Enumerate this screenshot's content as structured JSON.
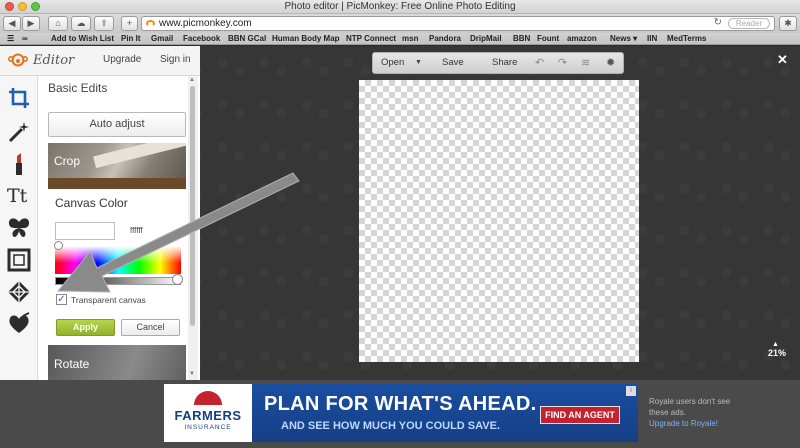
{
  "browser": {
    "window_title": "Photo editor | PicMonkey: Free Online Photo Editing",
    "url": "www.picmonkey.com",
    "reader_label": "Reader",
    "bookmarks": [
      "Add to Wish List",
      "Pin It",
      "Gmail",
      "Facebook",
      "BBN GCal",
      "Human Body Map",
      "NTP Connect",
      "msn",
      "Pandora",
      "DripMail",
      "BBN",
      "Fount",
      "amazon",
      "News ▾",
      "IIN",
      "MedTerms"
    ]
  },
  "header": {
    "logo_text": "Editor",
    "upgrade_label": "Upgrade",
    "signin_label": "Sign in"
  },
  "tools": [
    "crop-icon",
    "magic-wand-icon",
    "lipstick-icon",
    "text-icon",
    "butterfly-icon",
    "frame-icon",
    "texture-icon",
    "heart-icon"
  ],
  "panel": {
    "heading": "Basic Edits",
    "auto_adjust_label": "Auto adjust",
    "crop_label": "Crop",
    "canvas_color_title": "Canvas Color",
    "hex_value": "ffffff",
    "transparent_label": "Transparent canvas",
    "transparent_checked": true,
    "apply_label": "Apply",
    "cancel_label": "Cancel",
    "rotate_label": "Rotate"
  },
  "editor_toolbar": {
    "open_label": "Open",
    "save_label": "Save",
    "share_label": "Share"
  },
  "zoom_level": "21%",
  "ad": {
    "brand": "FARMERS",
    "brand_sub": "INSURANCE",
    "headline": "PLAN FOR WHAT'S AHEAD.",
    "subline": "AND SEE HOW MUCH YOU COULD SAVE.",
    "cta": "FIND AN AGENT"
  },
  "royale_note": {
    "text": "Royale users don't see these ads.",
    "link": "Upgrade to Royale!"
  }
}
